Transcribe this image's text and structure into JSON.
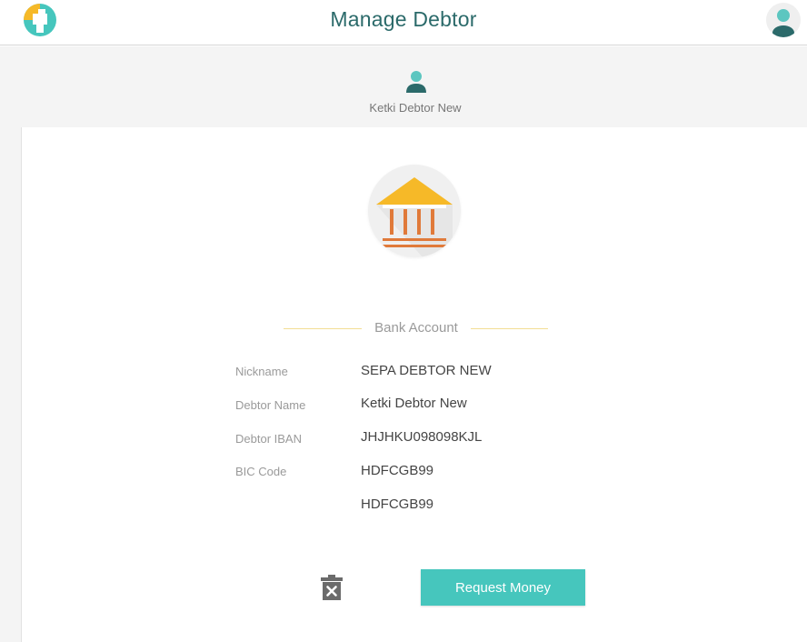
{
  "header": {
    "title": "Manage Debtor",
    "logo_icon": "app-logo-icon",
    "avatar_icon": "user-avatar-icon"
  },
  "profile": {
    "name": "Ketki Debtor New",
    "avatar_icon": "user-avatar-icon"
  },
  "bank_card": {
    "icon": "bank-icon",
    "section_title": "Bank Account",
    "fields": [
      {
        "label": "Nickname",
        "value": "SEPA DEBTOR NEW"
      },
      {
        "label": "Debtor Name",
        "value": "Ketki Debtor New"
      },
      {
        "label": "Debtor IBAN",
        "value": "JHJHKU098098KJL"
      },
      {
        "label": "BIC Code",
        "value": "HDFCGB99"
      },
      {
        "label": "",
        "value": "HDFCGB99"
      }
    ]
  },
  "actions": {
    "delete_icon": "trash-icon",
    "request_label": "Request Money"
  },
  "colors": {
    "accent": "#46c6bd",
    "title": "#2b6a6a",
    "bank_roof": "#f6b928",
    "bank_columns": "#e07a3a",
    "divider": "#f3dd94"
  }
}
